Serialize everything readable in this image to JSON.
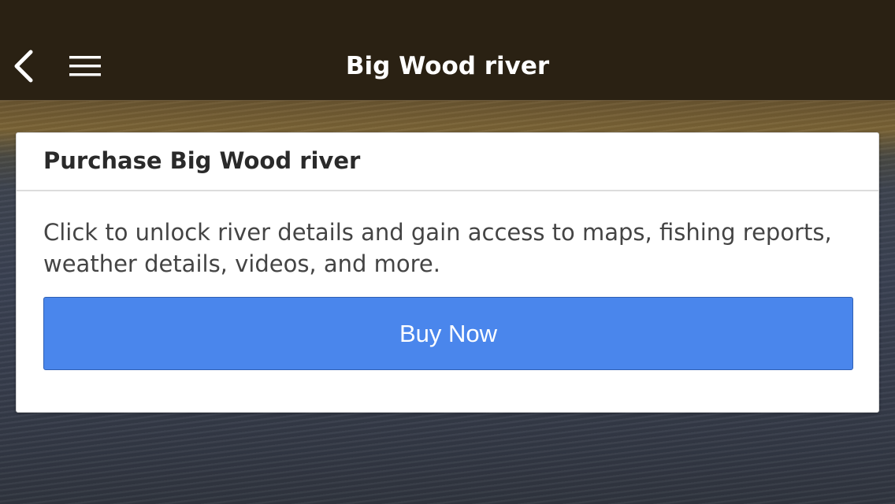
{
  "header": {
    "title": "Big Wood river",
    "back_icon": "chevron-left-icon",
    "menu_icon": "hamburger-menu-icon",
    "background_color": "#2a2113"
  },
  "purchase_card": {
    "title": "Purchase Big Wood river",
    "description": "Click to unlock river details and gain access to maps, fishing reports, weather details, videos, and more.",
    "buy_button_label": "Buy Now",
    "buy_button_color": "#4a86ec"
  }
}
